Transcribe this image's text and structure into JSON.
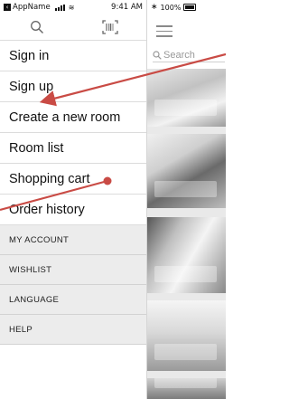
{
  "status_bar": {
    "back_app": "AppName",
    "time": "9:41 AM",
    "battery": "100%"
  },
  "background_app": {
    "search_placeholder": "Search"
  },
  "drawer": {
    "menu_items": [
      {
        "label": "Sign in"
      },
      {
        "label": "Sign up"
      },
      {
        "label": "Create a new room"
      },
      {
        "label": "Room list"
      },
      {
        "label": "Shopping cart"
      },
      {
        "label": "Order history"
      }
    ],
    "sub_items": [
      {
        "label": "MY ACCOUNT"
      },
      {
        "label": "WISHLIST"
      },
      {
        "label": "LANGUAGE"
      },
      {
        "label": "HELP"
      }
    ]
  },
  "icons": {
    "search": "search-icon",
    "scan": "barcode-scan-icon",
    "menu": "hamburger-menu-icon"
  },
  "colors": {
    "annotation": "#c94b45",
    "sub_menu_background": "#ececec"
  }
}
